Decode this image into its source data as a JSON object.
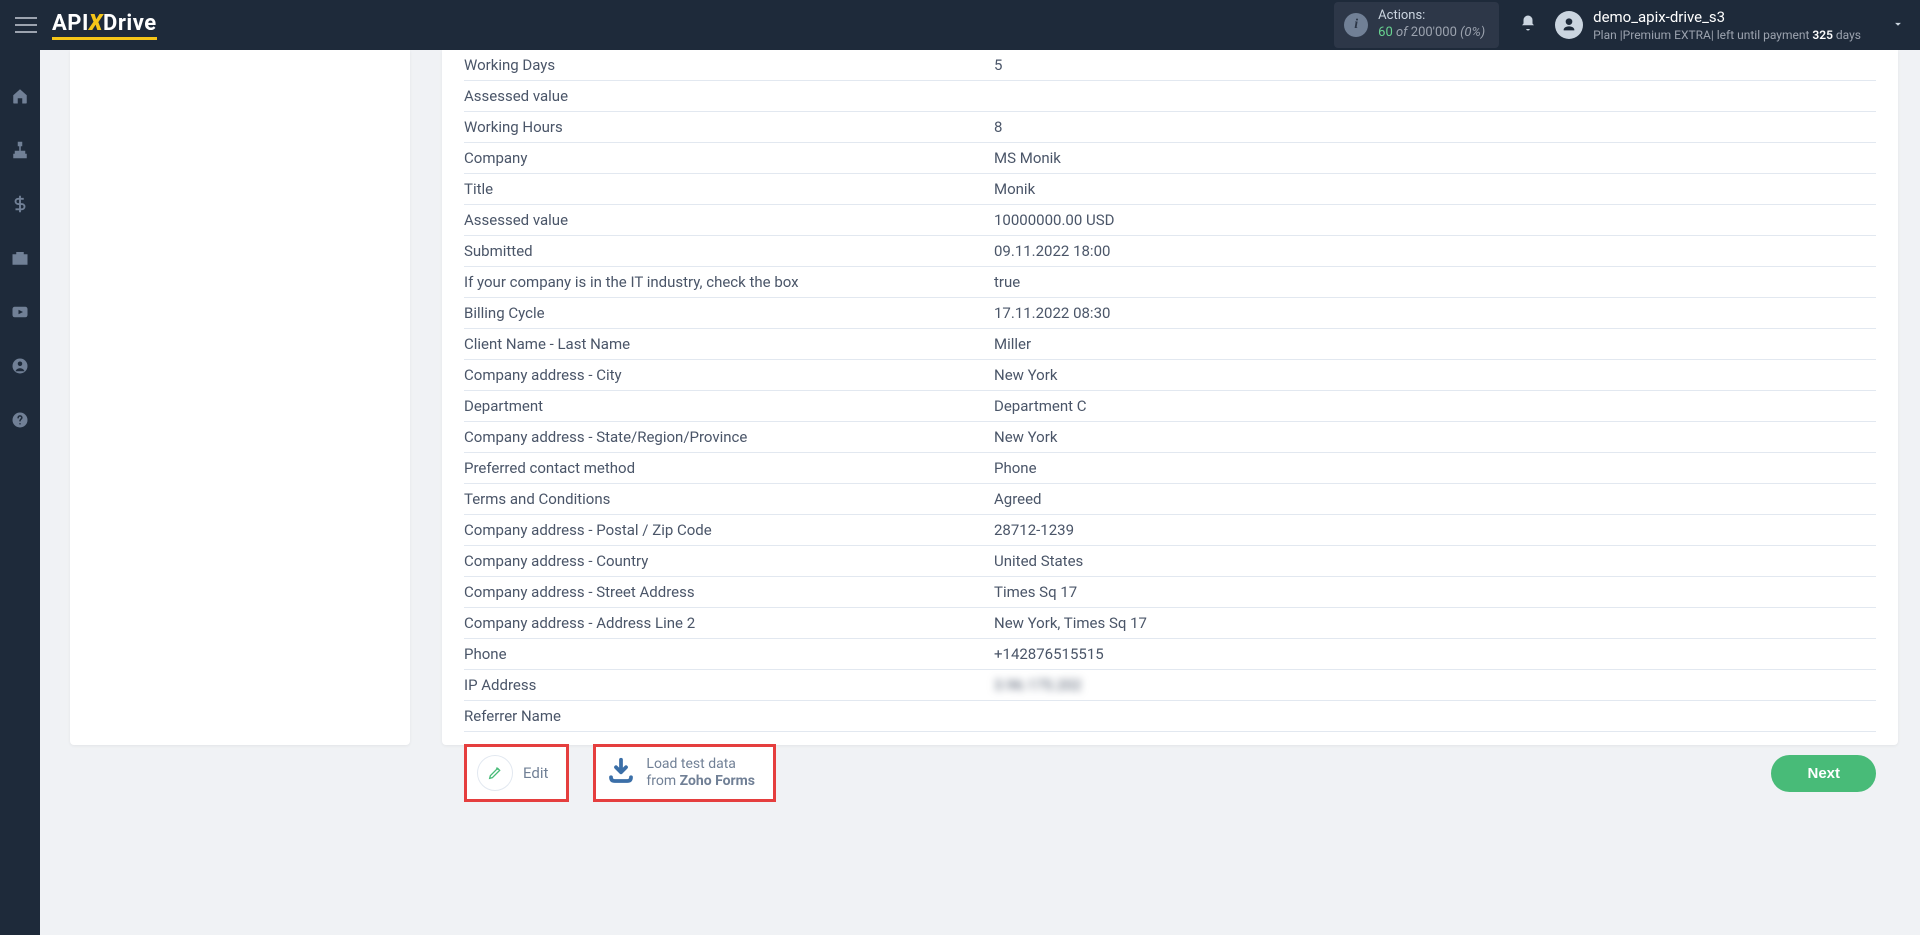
{
  "header": {
    "logo_pre": "API",
    "logo_x": "X",
    "logo_post": "Drive",
    "actions_label": "Actions:",
    "actions_count": "60",
    "actions_of": " of ",
    "actions_total": "200'000",
    "actions_pct": " (0%)",
    "user_name": "demo_apix-drive_s3",
    "plan_prefix": "Plan |",
    "plan_name": "Premium EXTRA",
    "plan_mid": "| left until payment ",
    "plan_days": "325",
    "plan_suffix": " days"
  },
  "sidebar_icons": [
    "home",
    "connections",
    "dollar",
    "toolbox",
    "youtube",
    "user",
    "help"
  ],
  "rows": [
    {
      "key": "Working Days",
      "val": "5"
    },
    {
      "key": "Assessed value",
      "val": ""
    },
    {
      "key": "Working Hours",
      "val": "8"
    },
    {
      "key": "Company",
      "val": "MS Monik"
    },
    {
      "key": "Title",
      "val": "Monik"
    },
    {
      "key": "Assessed value",
      "val": "10000000.00 USD"
    },
    {
      "key": "Submitted",
      "val": "09.11.2022 18:00"
    },
    {
      "key": "If your company is in the IT industry, check the box",
      "val": "true"
    },
    {
      "key": "Billing Cycle",
      "val": "17.11.2022 08:30"
    },
    {
      "key": "Client Name - Last Name",
      "val": "Miller"
    },
    {
      "key": "Company address - City",
      "val": "New York"
    },
    {
      "key": "Department",
      "val": "Department C"
    },
    {
      "key": "Company address - State/Region/Province",
      "val": "New York"
    },
    {
      "key": "Preferred contact method",
      "val": "Phone"
    },
    {
      "key": "Terms and Conditions",
      "val": "Agreed"
    },
    {
      "key": "Company address - Postal / Zip Code",
      "val": "28712-1239"
    },
    {
      "key": "Company address - Country",
      "val": "United States"
    },
    {
      "key": "Company address - Street Address",
      "val": "Times Sq 17"
    },
    {
      "key": "Company address - Address Line 2",
      "val": "New York, Times Sq 17"
    },
    {
      "key": "Phone",
      "val": "+142876515515"
    },
    {
      "key": "IP Address",
      "val": "3.96.175.202",
      "blur": true
    },
    {
      "key": "Referrer Name",
      "val": ""
    }
  ],
  "buttons": {
    "edit": "Edit",
    "load_line1": "Load test data",
    "load_from": "from ",
    "load_src": "Zoho Forms",
    "next": "Next"
  }
}
